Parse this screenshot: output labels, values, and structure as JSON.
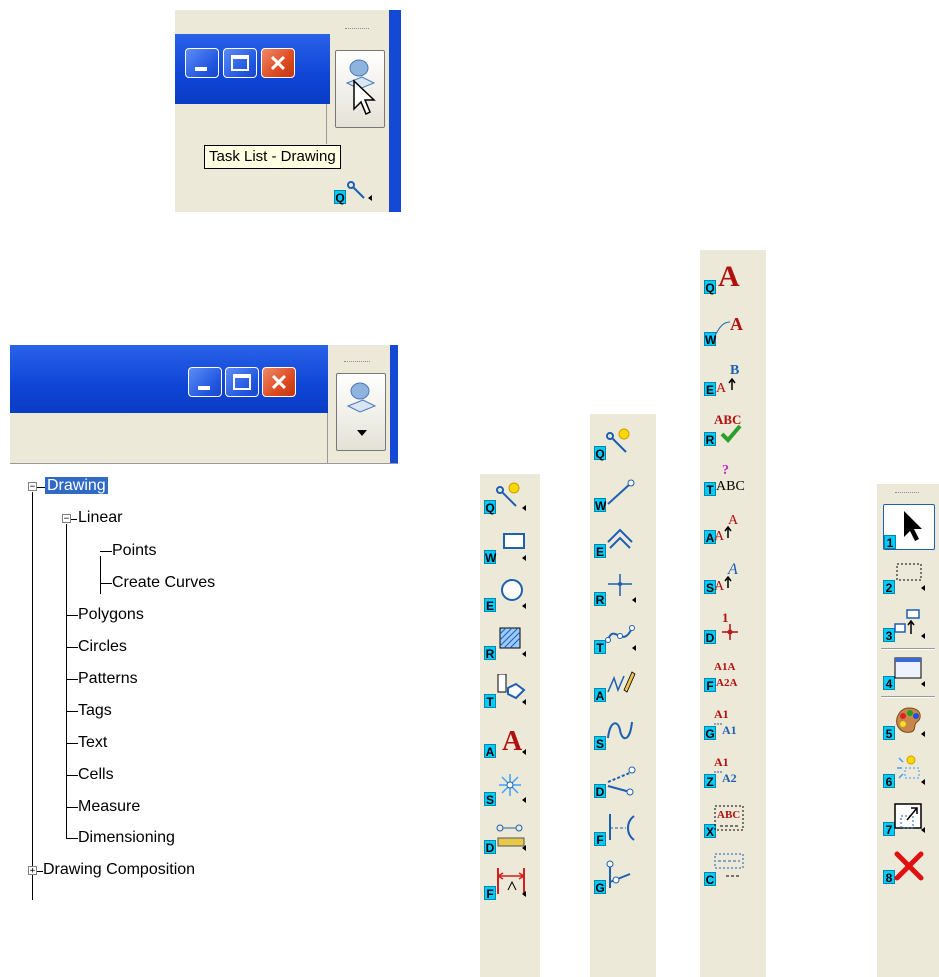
{
  "top_window": {
    "buttons": {
      "minimize": "minimize-icon",
      "maximize": "maximize-icon",
      "close": "close-icon"
    },
    "tooltip": "Task List - Drawing",
    "dock_key": "Q"
  },
  "tree": {
    "root": "Drawing",
    "linear": "Linear",
    "points": "Points",
    "create_curves": "Create Curves",
    "polygons": "Polygons",
    "circles": "Circles",
    "patterns": "Patterns",
    "tags": "Tags",
    "text": "Text",
    "cells": "Cells",
    "measure": "Measure",
    "dimensioning": "Dimensioning",
    "composition": "Drawing Composition"
  },
  "toolbar_drawing": {
    "keys": [
      "Q",
      "W",
      "E",
      "R",
      "T",
      "A",
      "S",
      "D",
      "F"
    ],
    "icons": [
      "element-selection-icon",
      "rectangle-icon",
      "circle-icon",
      "pattern-icon",
      "tag-icon",
      "text-icon",
      "point-icon",
      "measure-icon",
      "dimension-icon"
    ]
  },
  "toolbar_linear": {
    "keys": [
      "Q",
      "W",
      "E",
      "R",
      "T",
      "A",
      "S",
      "D",
      "F",
      "G"
    ],
    "icons": [
      "element-selection-icon",
      "line-icon",
      "smartline-icon",
      "point-icon",
      "curve-icon",
      "freehand-icon",
      "bspline-icon",
      "modify-icon",
      "arc-line-icon",
      "connect-icon"
    ]
  },
  "toolbar_text": {
    "keys": [
      "Q",
      "W",
      "E",
      "R",
      "T",
      "A",
      "S",
      "D",
      "F",
      "G",
      "Z",
      "X",
      "C"
    ],
    "icons": [
      "place-text-icon",
      "text-along-icon",
      "edit-text-icon",
      "spell-check-icon",
      "find-text-icon",
      "text-attributes-icon",
      "copy-text-icon",
      "increment-text-icon",
      "text-node-icon",
      "copy-number-icon",
      "increment-number-icon",
      "text-frame-icon",
      "empty-field-icon"
    ]
  },
  "toolbar_main": {
    "keys": [
      "1",
      "2",
      "3",
      "4",
      "5",
      "6",
      "7",
      "8"
    ],
    "icons": [
      "selection-arrow-icon",
      "fence-icon",
      "group-icon",
      "view-icon",
      "palette-icon",
      "smart-select-icon",
      "scale-icon",
      "delete-icon"
    ]
  }
}
